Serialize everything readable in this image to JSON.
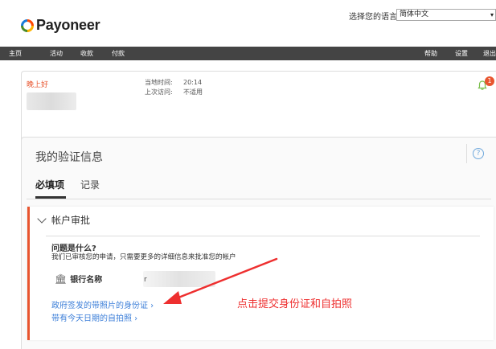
{
  "header": {
    "logo_text": "Payoneer",
    "language_label": "选择您的语言",
    "language_value": "简体中文"
  },
  "nav": {
    "left": [
      "主页",
      "活动",
      "收款",
      "付款"
    ],
    "right": [
      "帮助",
      "设置",
      "退出"
    ]
  },
  "greeting": {
    "title": "晚上好",
    "local_time_label": "当地时间:",
    "local_time_value": "20:14",
    "last_visit_label": "上次访问:",
    "last_visit_value": "不适用",
    "notification_count": "1"
  },
  "verification": {
    "title": "我的验证信息",
    "help_icon": "?",
    "tabs": [
      {
        "label": "必填项",
        "active": true
      },
      {
        "label": "记录",
        "active": false
      }
    ],
    "section_title": "帐户审批",
    "question": "问题是什么?",
    "description": "我们已审核您的申请，只需要更多的详细信息来批准您的帐户",
    "bank_label": "银行名称",
    "bank_value": "r",
    "links": [
      "政府签发的带照片的身份证 ›",
      "带有今天日期的自拍照 ›"
    ],
    "annotation": "点击提交身份证和自拍照"
  },
  "colors": {
    "accent": "#e8542e",
    "link": "#3b7ed8",
    "nav_bg": "#444444",
    "annotation": "#ee2f2f"
  }
}
